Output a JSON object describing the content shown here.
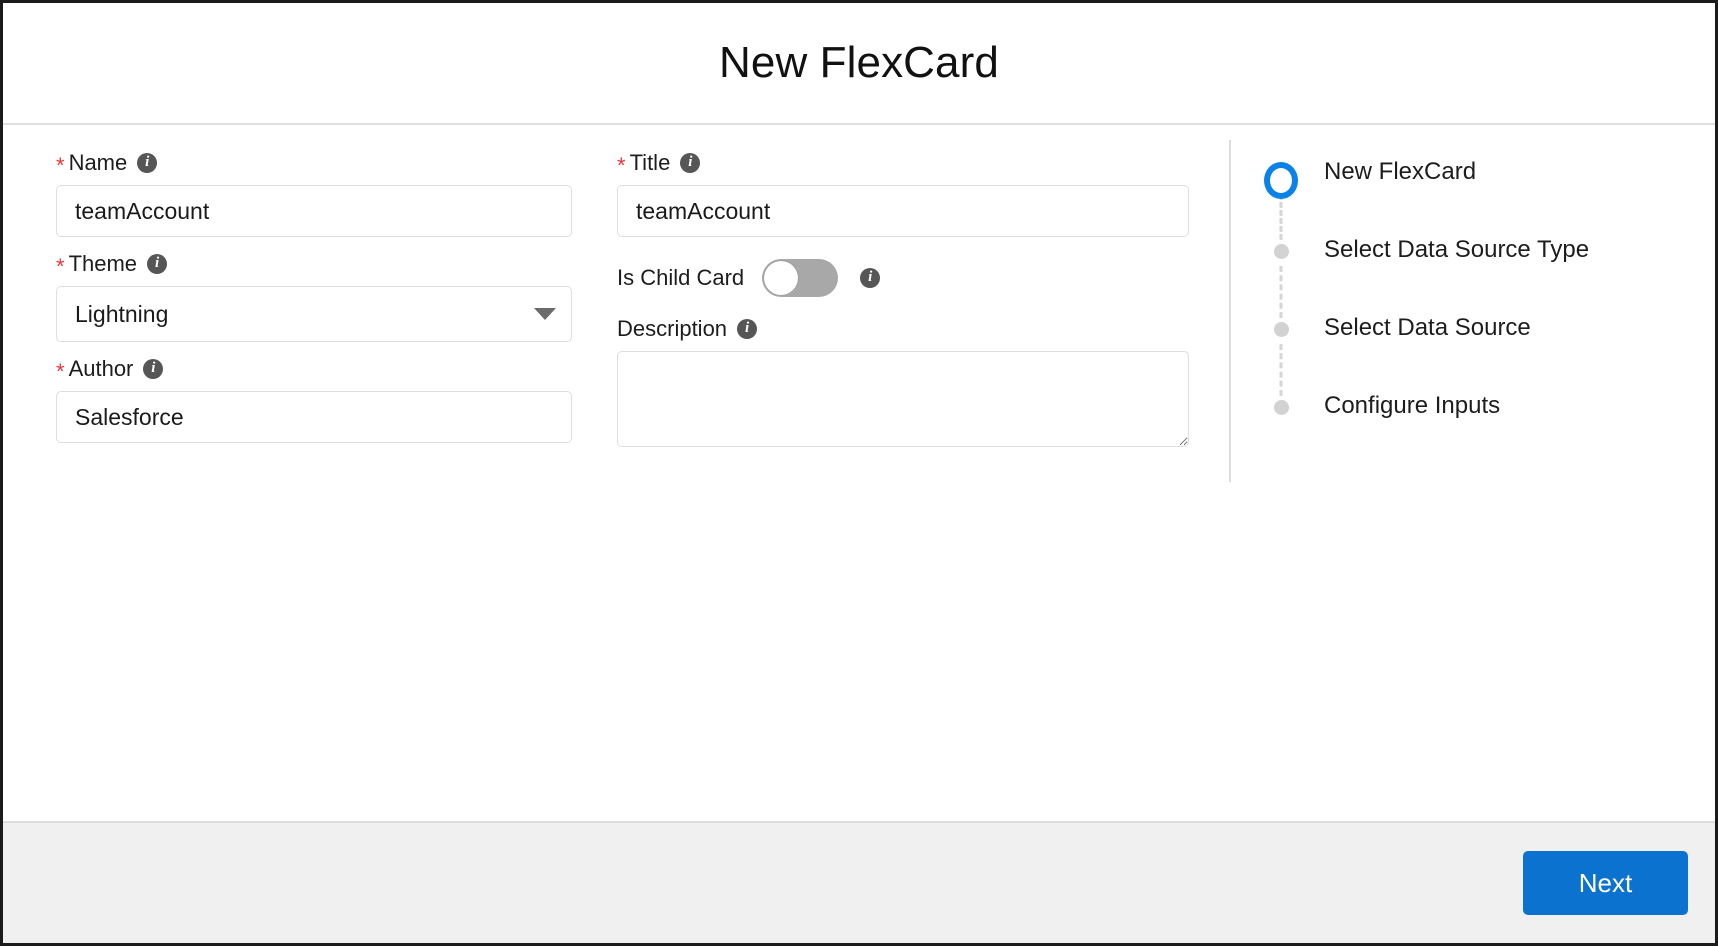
{
  "header": {
    "title": "New FlexCard"
  },
  "form": {
    "left_column": {
      "name_field": {
        "label": "Name",
        "required_marker": "*",
        "value": "teamAccount",
        "placeholder": "",
        "info_glyph": "i"
      },
      "theme_field": {
        "label": "Theme",
        "required_marker": "*",
        "value": "Lightning",
        "info_glyph": "i",
        "options": [
          "Lightning"
        ]
      },
      "author_field": {
        "label": "Author",
        "required_marker": "*",
        "value": "Salesforce",
        "placeholder": "",
        "info_glyph": "i"
      }
    },
    "middle_column": {
      "title_field": {
        "label": "Title",
        "required_marker": "*",
        "value": "teamAccount",
        "placeholder": "",
        "info_glyph": "i"
      },
      "is_child_card": {
        "label": "Is Child Card",
        "checked": false,
        "info_glyph": "i"
      },
      "description_field": {
        "label": "Description",
        "value": "",
        "placeholder": "",
        "info_glyph": "i"
      }
    }
  },
  "stepper": {
    "active_index": 0,
    "steps": [
      {
        "label": "New FlexCard",
        "state": "active"
      },
      {
        "label": "Select Data Source Type",
        "state": "pending"
      },
      {
        "label": "Select Data Source",
        "state": "pending"
      },
      {
        "label": "Configure Inputs",
        "state": "pending"
      }
    ]
  },
  "footer": {
    "next_label": "Next"
  },
  "colors": {
    "accent_blue": "#0b72d0",
    "step_active_blue": "#0b82e8",
    "required_red": "#e8373c",
    "info_icon_gray": "#565656",
    "toggle_off_gray": "#a8a8a8",
    "footer_background": "#f0f0f0",
    "border_gray": "#dedede"
  }
}
